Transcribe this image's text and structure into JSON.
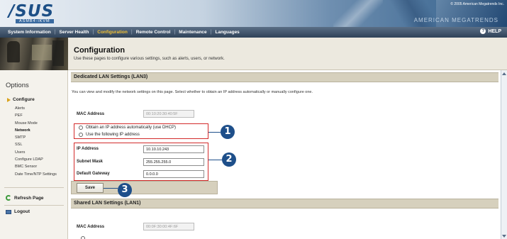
{
  "banner": {
    "logo": "/SUS",
    "model": "ASMB4-iKVM",
    "copyright": "© 2005 American Megatrends Inc.",
    "deco_text": "AMERICAN MEGATRENDS"
  },
  "menu": {
    "items": [
      {
        "label": "System Information",
        "active": false
      },
      {
        "label": "Server Health",
        "active": false
      },
      {
        "label": "Configuration",
        "active": true
      },
      {
        "label": "Remote Control",
        "active": false
      },
      {
        "label": "Maintenance",
        "active": false
      },
      {
        "label": "Languages",
        "active": false
      }
    ],
    "help_icon": "?",
    "help_label": "HELP",
    "active_color": "#f2c033"
  },
  "header": {
    "title": "Configuration",
    "description": "Use these pages to configure various settings, such as alerts, users, or network."
  },
  "sidebar": {
    "title": "Options",
    "group": "Configure",
    "items": [
      {
        "label": "Alerts",
        "bold": false
      },
      {
        "label": "PEF",
        "bold": false
      },
      {
        "label": "Mouse Mode",
        "bold": false
      },
      {
        "label": "Network",
        "bold": true
      },
      {
        "label": "SMTP",
        "bold": false
      },
      {
        "label": "SSL",
        "bold": false
      },
      {
        "label": "Users",
        "bold": false
      },
      {
        "label": "Configure LDAP",
        "bold": false
      },
      {
        "label": "BMC Sensor",
        "bold": false
      },
      {
        "label": "Date Time/NTP Settings",
        "bold": false
      }
    ],
    "refresh_label": "Refresh Page",
    "logout_label": "Logout"
  },
  "lan3": {
    "section_title": "Dedicated LAN Settings (LAN3)",
    "intro": "You can view and modify the network settings on this page. Select whether to obtain an IP address automatically or manually configure one.",
    "mac_label": "MAC Address",
    "mac_value": "00:10:20:30:40:5F",
    "radio_auto": "Obtain an IP address automatically (use DHCP)",
    "radio_manual": "Use the following IP address",
    "ip_label": "IP Address",
    "ip_value": "10.10.10.243",
    "mask_label": "Subnet Mask",
    "mask_value": "255.255.255.0",
    "gateway_label": "Default Gateway",
    "gateway_value": "0.0.0.0",
    "save_label": "Save"
  },
  "lan1": {
    "section_title": "Shared LAN Settings (LAN1)",
    "mac_label": "MAC Address",
    "mac_value": "00:0F:30:00:4F:6F"
  },
  "callouts": {
    "one": "1",
    "two": "2",
    "three": "3"
  },
  "colors": {
    "callout": "#1e4f8a",
    "highlight_box": "#d32b2b",
    "section_bar": "#d6d0bd"
  }
}
